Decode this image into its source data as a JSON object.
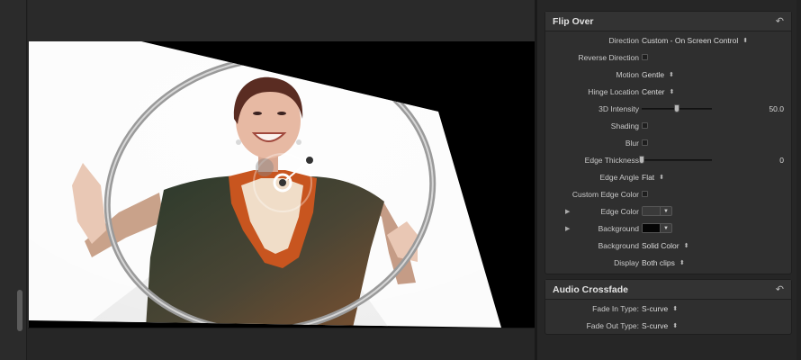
{
  "flip_over": {
    "title": "Flip Over",
    "params": {
      "direction": {
        "label": "Direction",
        "value": "Custom - On Screen Control"
      },
      "reverse_direction": {
        "label": "Reverse Direction",
        "checked": false
      },
      "motion": {
        "label": "Motion",
        "value": "Gentle"
      },
      "hinge_location": {
        "label": "Hinge Location",
        "value": "Center"
      },
      "intensity_3d": {
        "label": "3D Intensity",
        "value": "50.0",
        "fraction": 0.5
      },
      "shading": {
        "label": "Shading",
        "checked": false
      },
      "blur": {
        "label": "Blur",
        "checked": false
      },
      "edge_thickness": {
        "label": "Edge Thickness",
        "value": "0",
        "fraction": 0.0
      },
      "edge_angle": {
        "label": "Edge Angle",
        "value": "Flat"
      },
      "custom_edge_color": {
        "label": "Custom Edge Color",
        "checked": false
      },
      "edge_color": {
        "label": "Edge Color",
        "color": "#3a3a3a"
      },
      "background_color": {
        "label": "Background",
        "color": "#050505"
      },
      "background": {
        "label": "Background",
        "value": "Solid Color"
      },
      "display": {
        "label": "Display",
        "value": "Both clips"
      }
    }
  },
  "audio_crossfade": {
    "title": "Audio Crossfade",
    "params": {
      "fade_in": {
        "label": "Fade In Type:",
        "value": "S-curve"
      },
      "fade_out": {
        "label": "Fade Out Type:",
        "value": "S-curve"
      }
    }
  },
  "icons": {
    "reset": "reset-arrow-icon",
    "disclosure": "disclosure-triangle-icon",
    "popup": "updown-arrows-icon"
  },
  "colors": {
    "panel_bg": "#2f2f2f",
    "viewer_bg": "#000000",
    "frame_white": "#fbfbfb",
    "scarf_orange": "#c8551f"
  }
}
